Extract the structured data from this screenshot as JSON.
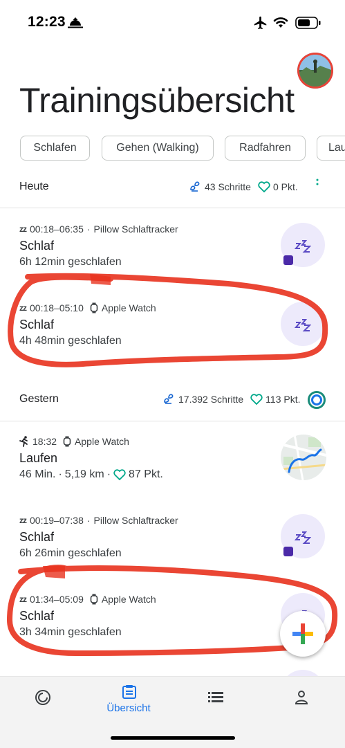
{
  "status_bar": {
    "time": "12:23"
  },
  "page": {
    "title": "Trainingsübersicht"
  },
  "chips": [
    "Schlafen",
    "Gehen (Walking)",
    "Radfahren",
    "Lau"
  ],
  "today": {
    "label": "Heute",
    "steps": "43 Schritte",
    "points": "0 Pkt.",
    "entries": [
      {
        "time": "00:18–06:35",
        "source": "Pillow Schlaftracker",
        "name": "Schlaf",
        "detail": "6h 12min geschlafen"
      },
      {
        "time": "00:18–05:10",
        "source": "Apple Watch",
        "name": "Schlaf",
        "detail": "4h 48min geschlafen"
      }
    ]
  },
  "yesterday": {
    "label": "Gestern",
    "steps": "17.392 Schritte",
    "points": "113 Pkt.",
    "entries": [
      {
        "time": "18:32",
        "source": "Apple Watch",
        "name": "Laufen",
        "duration": "46 Min.",
        "distance": "5,19 km",
        "points": "87 Pkt."
      },
      {
        "time": "00:19–07:38",
        "source": "Pillow Schlaftracker",
        "name": "Schlaf",
        "detail": "6h 26min geschlafen"
      },
      {
        "time": "01:34–05:09",
        "source": "Apple Watch",
        "name": "Schlaf",
        "detail": "3h 34min geschlafen"
      }
    ]
  },
  "bottom_nav": {
    "items": [
      "journal-ring-icon",
      "overview-icon",
      "list-icon",
      "profile-icon"
    ],
    "active_label": "Übersicht"
  },
  "colors": {
    "accent": "#1a73e8",
    "heart": "#00a88a",
    "steps": "#1967d2",
    "sleep_bubble": "#edeafb",
    "annotation": "#e8321e"
  }
}
